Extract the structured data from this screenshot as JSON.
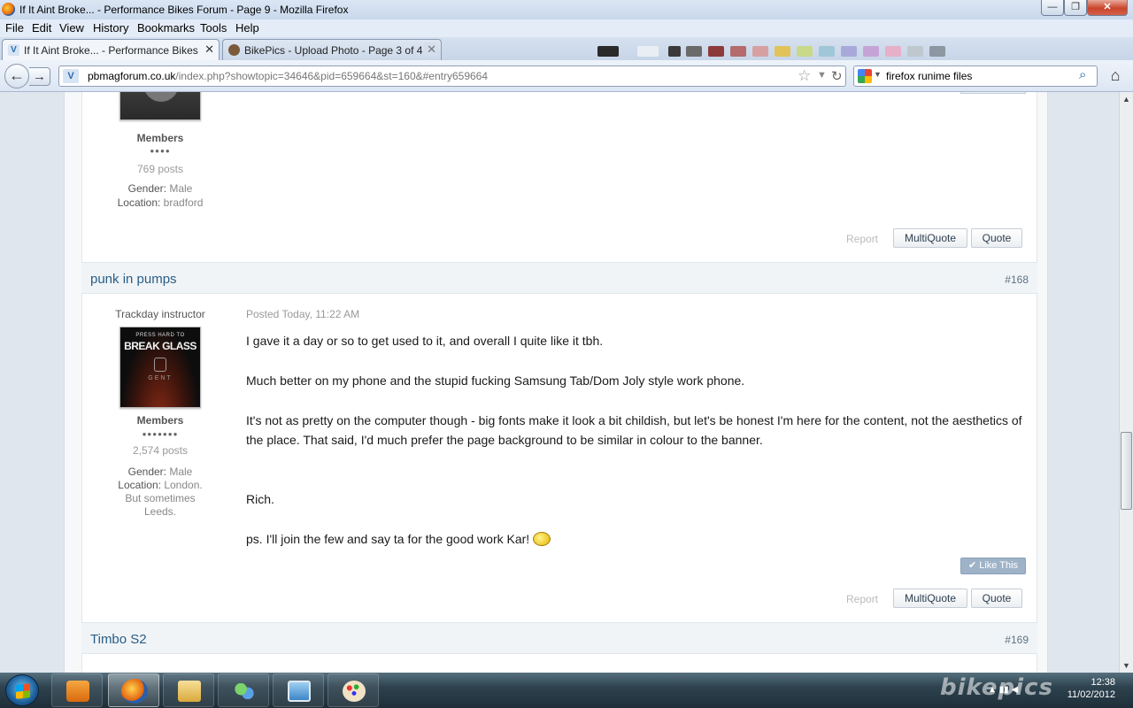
{
  "window": {
    "title": "If It Aint Broke... - Performance Bikes Forum - Page 9 - Mozilla Firefox",
    "min": "—",
    "max": "❐",
    "close": "✕"
  },
  "menu": [
    "File",
    "Edit",
    "View",
    "History",
    "Bookmarks",
    "Tools",
    "Help"
  ],
  "tabs": [
    {
      "label": "If It Aint Broke... - Performance Bikes ...",
      "close": "✕"
    },
    {
      "label": "BikePics - Upload Photo - Page 3 of 4",
      "close": "✕"
    }
  ],
  "newtab": "+",
  "nav": {
    "back": "←",
    "forward": "→",
    "url_domain": "pbmagforum.co.uk",
    "url_path": "/index.php?showtopic=34646&pid=659664&st=160&#entry659664",
    "search_value": "firefox runime files",
    "home": "⌂"
  },
  "posts": [
    {
      "role": "Members",
      "pips": "●●●●",
      "posts_count": "769 posts",
      "gender_label": "Gender:",
      "gender": "Male",
      "location_label": "Location:",
      "location": "bradford",
      "report": "Report",
      "multiquote": "MultiQuote",
      "quote": "Quote"
    },
    {
      "author": "punk in pumps",
      "number": "#168",
      "title": "Trackday instructor",
      "role": "Members",
      "pips": "●●●●●●●",
      "posts_count": "2,574 posts",
      "gender_label": "Gender:",
      "gender": "Male",
      "location_label": "Location:",
      "location": "London. But sometimes Leeds.",
      "posted": "Posted Today, 11:22 AM",
      "avatar_text": [
        "PRESS HARD TO",
        "BREAK GLASS",
        "GENT"
      ],
      "body": [
        "I gave it a day or so to get used to it, and overall I quite like it tbh.",
        "Much better on my phone and the stupid fucking Samsung Tab/Dom Joly style work phone.",
        "It's not as pretty on the computer though - big fonts make it look a bit childish, but let's be honest I'm here for the content, not the aesthetics of the place. That said, I'd much prefer the page background to be similar in colour to the banner.",
        "Rich.",
        "ps. I'll join the few and say ta for the good work Kar!"
      ],
      "like": "✔ Like This",
      "report": "Report",
      "multiquote": "MultiQuote",
      "quote": "Quote"
    },
    {
      "author": "Timbo S2",
      "number": "#169"
    }
  ],
  "taskbar": {
    "clock_time": "12:38",
    "clock_date": "11/02/2012",
    "watermark": "bikepics"
  },
  "colors": {
    "link": "#2a5d84",
    "accent": "#9fb3c8",
    "taskbar": "#2e434f"
  }
}
